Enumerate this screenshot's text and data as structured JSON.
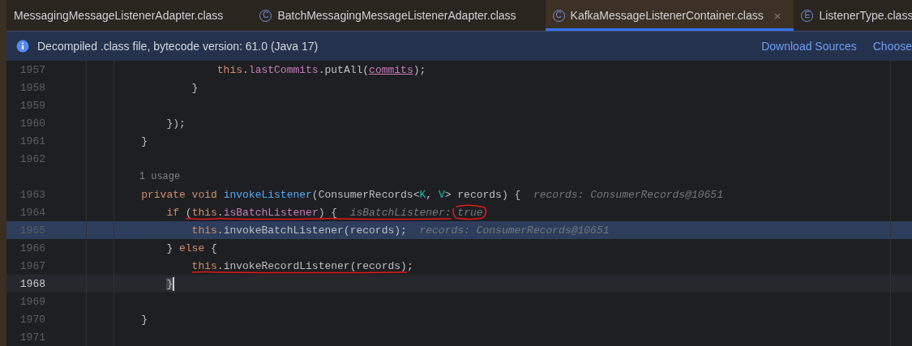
{
  "tabs": [
    {
      "label": "MessagingMessageListenerAdapter.class",
      "selected": false
    },
    {
      "icon": "C",
      "label": "BatchMessagingMessageListenerAdapter.class",
      "selected": false
    },
    {
      "icon": "C",
      "label": "KafkaMessageListenerContainer.class",
      "selected": true,
      "close": "×"
    },
    {
      "icon": "E",
      "label": "ListenerType.class",
      "selected": false
    }
  ],
  "banner": {
    "message": "Decompiled .class file, bytecode version: 61.0 (Java 17)",
    "links": [
      "Download Sources",
      "Choose"
    ]
  },
  "editor": {
    "lines": [
      {
        "kind": "code",
        "number": "1957",
        "execution_point": false,
        "caret": false,
        "tokens": [
          {
            "kind": "keyword",
            "text": "                this"
          },
          {
            "kind": "plain",
            "text": "."
          },
          {
            "kind": "field",
            "text": "lastCommits"
          },
          {
            "kind": "plain",
            "text": ".putAll("
          },
          {
            "kind": "captured",
            "text": "commits"
          },
          {
            "kind": "plain",
            "text": ");"
          }
        ]
      },
      {
        "kind": "code",
        "number": "1958",
        "execution_point": false,
        "caret": false,
        "tokens": [
          {
            "kind": "plain",
            "text": "            }"
          }
        ]
      },
      {
        "kind": "code",
        "number": "1959",
        "execution_point": false,
        "caret": false
      },
      {
        "kind": "code",
        "number": "1960",
        "execution_point": false,
        "caret": false,
        "tokens": [
          {
            "kind": "plain",
            "text": "        });"
          }
        ]
      },
      {
        "kind": "code",
        "number": "1961",
        "execution_point": false,
        "caret": false,
        "tokens": [
          {
            "kind": "plain",
            "text": "    }"
          }
        ]
      },
      {
        "kind": "code",
        "number": "1962",
        "execution_point": false,
        "caret": false
      },
      {
        "kind": "usage",
        "text": "    1 usage"
      },
      {
        "kind": "code",
        "number": "1963",
        "execution_point": false,
        "caret": false,
        "tokens": [
          {
            "kind": "keyword",
            "text": "    private void "
          },
          {
            "kind": "method",
            "text": "invokeListener"
          },
          {
            "kind": "plain",
            "text": "(ConsumerRecords<"
          },
          {
            "kind": "type_param",
            "text": "K"
          },
          {
            "kind": "plain",
            "text": ", "
          },
          {
            "kind": "type_param",
            "text": "V"
          },
          {
            "kind": "plain",
            "text": "> records) {"
          }
        ],
        "hint": {
          "text": "records: ConsumerRecords@10651"
        }
      },
      {
        "kind": "code",
        "number": "1964",
        "execution_point": false,
        "caret": false,
        "tokens": [
          {
            "kind": "keyword",
            "text": "        if "
          },
          {
            "kind": "plain",
            "text": "(",
            "marked": true
          },
          {
            "kind": "keyword",
            "text": "this",
            "marked": true
          },
          {
            "kind": "plain",
            "text": ".",
            "marked": true
          },
          {
            "kind": "field",
            "text": "isBatchListener",
            "marked": true
          },
          {
            "kind": "plain",
            "text": ") {",
            "marked": true
          }
        ],
        "hint": {
          "text": "isBatchListener: true",
          "label_marked": true,
          "value_circled": true
        }
      },
      {
        "kind": "code",
        "number": "1965",
        "execution_point": true,
        "caret": false,
        "tokens": [
          {
            "kind": "keyword",
            "text": "            this"
          },
          {
            "kind": "plain",
            "text": ".invokeBatchListener(records);"
          }
        ],
        "hint": {
          "text": "records: ConsumerRecords@10651"
        }
      },
      {
        "kind": "code",
        "number": "1966",
        "execution_point": false,
        "caret": false,
        "tokens": [
          {
            "kind": "plain",
            "text": "        } "
          },
          {
            "kind": "keyword",
            "text": "else"
          },
          {
            "kind": "plain",
            "text": " {"
          }
        ]
      },
      {
        "kind": "code",
        "number": "1967",
        "execution_point": false,
        "caret": false,
        "tokens": [
          {
            "kind": "keyword",
            "text": "            this",
            "marked": true
          },
          {
            "kind": "plain",
            "text": ".invokeRecordListener(records)",
            "marked": true
          },
          {
            "kind": "plain",
            "text": ";"
          }
        ]
      },
      {
        "kind": "code",
        "number": "1968",
        "execution_point": false,
        "caret": true,
        "tokens": [
          {
            "kind": "plain",
            "text": "        }"
          }
        ]
      },
      {
        "kind": "code",
        "number": "1969",
        "execution_point": false,
        "caret": false
      },
      {
        "kind": "code",
        "number": "1970",
        "execution_point": false,
        "caret": false,
        "tokens": [
          {
            "kind": "plain",
            "text": "    }"
          }
        ]
      },
      {
        "kind": "code",
        "number": "1971",
        "execution_point": false,
        "caret": false
      }
    ]
  }
}
